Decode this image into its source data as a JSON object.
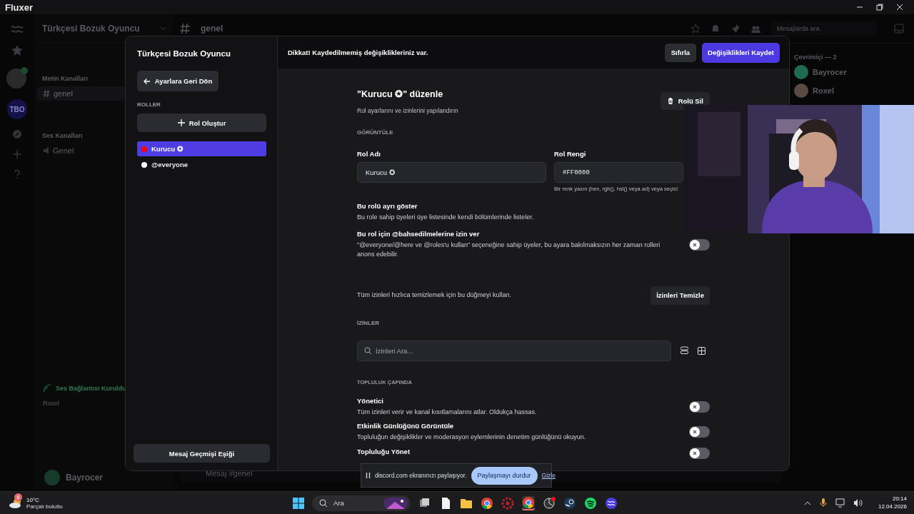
{
  "titlebar": {
    "title": "Fluxer"
  },
  "app": {
    "rail": {
      "server_badge": "TBO"
    },
    "server_name": "Türkçesi Bozuk Oyuncu",
    "channel_title": "genel",
    "search_placeholder": "Mesajlarda ara",
    "categories": [
      {
        "name": "Metin Kanalları",
        "channels": [
          {
            "name": "genel",
            "kind": "text",
            "selected": true
          }
        ]
      },
      {
        "name": "Ses Kanalları",
        "channels": [
          {
            "name": "Genel",
            "kind": "voice",
            "selected": false
          }
        ]
      }
    ],
    "voice_status": "Ses Bağlantısı Kuruldu",
    "voice_server": "Roxel",
    "user": {
      "name": "Bayrocer"
    },
    "composer_placeholder": "Mesaj #genel",
    "members": {
      "heading": "Çevrimiçi — 2",
      "list": [
        {
          "name": "Bayrocer",
          "color": "#1f6b4f"
        },
        {
          "name": "Roxel",
          "color": "#5a4a44"
        }
      ]
    }
  },
  "modal": {
    "sidebar": {
      "title": "Türkçesi Bozuk Oyuncu",
      "back_button": "Ayarlara Geri Dön",
      "section": "ROLLER",
      "create_button": "Rol Oluştur",
      "roles": [
        {
          "name": "Kurucu ✪",
          "color": "#ff0000",
          "selected": true
        },
        {
          "name": "@everyone",
          "color": "#ffffff",
          "selected": false
        }
      ],
      "footer_button": "Mesaj Geçmişi Eşiği"
    },
    "unsaved_bar": {
      "message": "Dikkat! Kaydedilmemiş değişiklikleriniz var.",
      "reset_button": "Sıfırla",
      "save_button": "Değişiklikleri Kaydet"
    },
    "title": "\"Kurucu ✪\" düzenle",
    "subtitle": "Rol ayarlarını ve izinlerini yapılandırın",
    "delete_button": "Rolü Sil",
    "display_section": "GÖRÜNTÜLE",
    "name_field": {
      "label": "Rol Adı",
      "value": "Kurucu ✪"
    },
    "color_field": {
      "label": "Rol Rengi",
      "value": "#FF0000",
      "hint": "Bir renk yazın (hex, rgb(), hsl() veya ad) veya seçici"
    },
    "settings": [
      {
        "title": "Bu rolü ayrı göster",
        "description": "Bu role sahip üyeleri üye listesinde kendi bölümlerinde listeler."
      },
      {
        "title": "Bu rol için @bahsedilmelerine izin ver",
        "description": "\"@everyone/@here ve @roles'u kullan\" seçeneğine sahip üyeler, bu ayara bakılmaksızın her zaman rolleri anons edebilir.",
        "on": false
      }
    ],
    "clear_text": "Tüm izinleri hızlıca temizlemek için bu düğmeyi kullan.",
    "clear_button": "İzinleri Temizle",
    "permissions_section": "İZİNLER",
    "permission_search": {
      "placeholder": "İzinleri Ara..."
    },
    "group": "TOPLULUK ÇAPINDA",
    "permissions": [
      {
        "title": "Yönetici",
        "description": "Tüm izinleri verir ve kanal kısıtlamalarını atlar. Oldukça hassas.",
        "on": false
      },
      {
        "title": "Etkinlik Günlüğünü Görüntüle",
        "description": "Topluluğun değişiklikler ve moderasyon eylemlerinin denetim günlüğünü okuyun.",
        "on": false
      },
      {
        "title": "Topluluğu Yönet",
        "on": false
      }
    ]
  },
  "share_bar": {
    "message": "discord.com ekranınızı paylaşıyor.",
    "stop_button": "Paylaşmayı durdur",
    "hide_link": "Gizle"
  },
  "taskbar": {
    "weather": {
      "badge": "6",
      "temperature": "10°C",
      "condition": "Parçalı bulutlu"
    },
    "search": {
      "placeholder": "Ara"
    },
    "time": "20:14",
    "date": "12.04.2026"
  }
}
